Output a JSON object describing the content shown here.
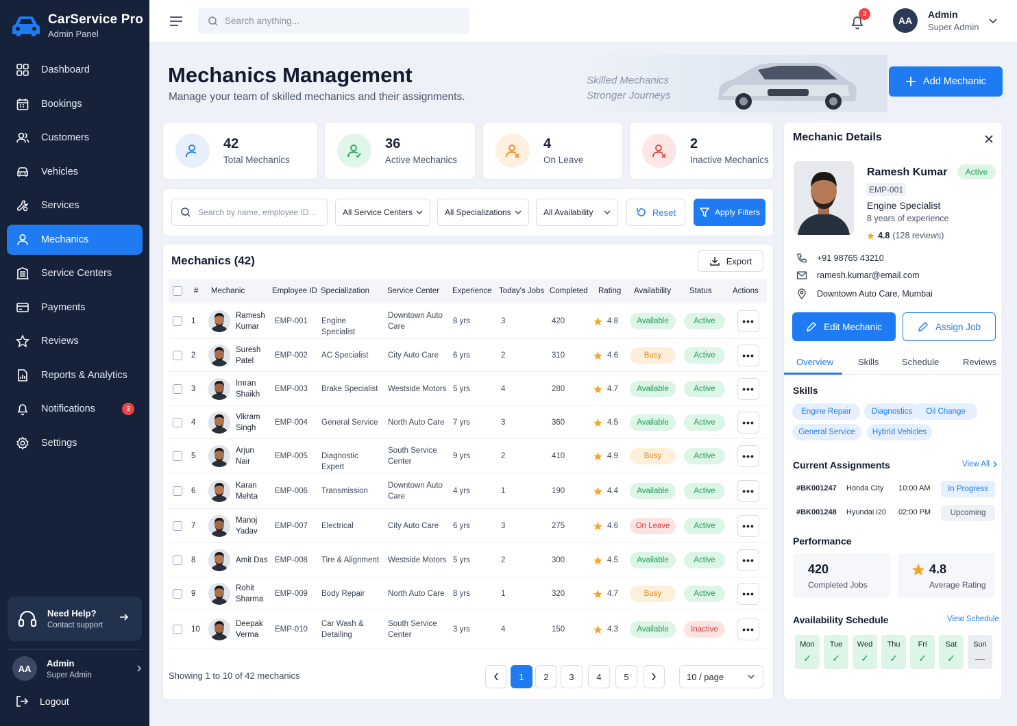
{
  "brand": {
    "name": "CarService Pro",
    "sub": "Admin Panel"
  },
  "nav": [
    {
      "label": "Dashboard",
      "icon": "dashboard-icon"
    },
    {
      "label": "Bookings",
      "icon": "calendar-icon"
    },
    {
      "label": "Customers",
      "icon": "users-icon"
    },
    {
      "label": "Vehicles",
      "icon": "car-icon"
    },
    {
      "label": "Services",
      "icon": "wrench-icon"
    },
    {
      "label": "Mechanics",
      "icon": "user-icon",
      "active": true
    },
    {
      "label": "Service Centers",
      "icon": "building-icon"
    },
    {
      "label": "Payments",
      "icon": "card-icon"
    },
    {
      "label": "Reviews",
      "icon": "star-icon"
    },
    {
      "label": "Reports & Analytics",
      "icon": "report-icon"
    },
    {
      "label": "Notifications",
      "icon": "bell-icon",
      "badge": "3"
    },
    {
      "label": "Settings",
      "icon": "gear-icon"
    }
  ],
  "help": {
    "title": "Need Help?",
    "sub": "Contact support"
  },
  "side_user": {
    "initials": "AA",
    "name": "Admin",
    "role": "Super Admin"
  },
  "logout": "Logout",
  "top": {
    "search_placeholder": "Search anything...",
    "notif_count": "3",
    "initials": "AA",
    "name": "Admin",
    "role": "Super Admin"
  },
  "header": {
    "title": "Mechanics Management",
    "subtitle": "Manage your team of skilled mechanics and their assignments.",
    "tagline1": "Skilled Mechanics",
    "tagline2": "Stronger Journeys",
    "add_label": "Add Mechanic"
  },
  "stats": [
    {
      "value": "42",
      "label": "Total Mechanics",
      "color": "#1f7bf2",
      "bg": "#e6f0ff"
    },
    {
      "value": "36",
      "label": "Active Mechanics",
      "color": "#22a35a",
      "bg": "#e1f6ea"
    },
    {
      "value": "4",
      "label": "On Leave",
      "color": "#f08a24",
      "bg": "#fff0e0"
    },
    {
      "value": "2",
      "label": "Inactive Mechanics",
      "color": "#e0443e",
      "bg": "#fde6e5"
    }
  ],
  "filters": {
    "search_placeholder": "Search by name, employee ID...",
    "centers": "All Service Centers",
    "specs": "All Specializations",
    "availability": "All Availability",
    "reset": "Reset",
    "apply": "Apply Filters"
  },
  "table": {
    "title": "Mechanics (42)",
    "export": "Export",
    "headers": [
      "#",
      "Mechanic",
      "Employee ID",
      "Specialization",
      "Service Center",
      "Experience",
      "Today's Jobs",
      "Completed",
      "Rating",
      "Availability",
      "Status",
      "Actions"
    ],
    "rows": [
      {
        "n": "1",
        "first": "Ramesh",
        "last": "Kumar",
        "id": "EMP-001",
        "spec": "Engine Specialist",
        "center": "Downtown Auto Care",
        "exp": "8 yrs",
        "today": "3",
        "done": "420",
        "rating": "4.8",
        "avail": "Available",
        "status": "Active"
      },
      {
        "n": "2",
        "first": "Suresh",
        "last": "Patel",
        "id": "EMP-002",
        "spec": "AC Specialist",
        "center": "City Auto Care",
        "exp": "6 yrs",
        "today": "2",
        "done": "310",
        "rating": "4.6",
        "avail": "Busy",
        "status": "Active"
      },
      {
        "n": "3",
        "first": "Imran",
        "last": "Shaikh",
        "id": "EMP-003",
        "spec": "Brake Specialist",
        "center": "Westside Motors",
        "exp": "5 yrs",
        "today": "4",
        "done": "280",
        "rating": "4.7",
        "avail": "Available",
        "status": "Active"
      },
      {
        "n": "4",
        "first": "Vikram",
        "last": "Singh",
        "id": "EMP-004",
        "spec": "General Service",
        "center": "North Auto Care",
        "exp": "7 yrs",
        "today": "3",
        "done": "360",
        "rating": "4.5",
        "avail": "Available",
        "status": "Active"
      },
      {
        "n": "5",
        "first": "Arjun",
        "last": "Nair",
        "id": "EMP-005",
        "spec": "Diagnostic Expert",
        "center": "South Service Center",
        "exp": "9 yrs",
        "today": "2",
        "done": "410",
        "rating": "4.9",
        "avail": "Busy",
        "status": "Active"
      },
      {
        "n": "6",
        "first": "Karan",
        "last": "Mehta",
        "id": "EMP-006",
        "spec": "Transmission",
        "center": "Downtown Auto Care",
        "exp": "4 yrs",
        "today": "1",
        "done": "190",
        "rating": "4.4",
        "avail": "Available",
        "status": "Active"
      },
      {
        "n": "7",
        "first": "Manoj",
        "last": "Yadav",
        "id": "EMP-007",
        "spec": "Electrical",
        "center": "City Auto Care",
        "exp": "6 yrs",
        "today": "3",
        "done": "275",
        "rating": "4.6",
        "avail": "On Leave",
        "status": "Active"
      },
      {
        "n": "8",
        "first": "Amit Das",
        "last": "",
        "id": "EMP-008",
        "spec": "Tire & Alignment",
        "center": "Westside Motors",
        "exp": "5 yrs",
        "today": "2",
        "done": "300",
        "rating": "4.5",
        "avail": "Available",
        "status": "Active"
      },
      {
        "n": "9",
        "first": "Rohit",
        "last": "Sharma",
        "id": "EMP-009",
        "spec": "Body Repair",
        "center": "North Auto Care",
        "exp": "8 yrs",
        "today": "1",
        "done": "320",
        "rating": "4.7",
        "avail": "Busy",
        "status": "Active"
      },
      {
        "n": "10",
        "first": "Deepak",
        "last": "Verma",
        "id": "EMP-010",
        "spec": "Car Wash & Detailing",
        "center": "South Service Center",
        "exp": "3 yrs",
        "today": "4",
        "done": "150",
        "rating": "4.3",
        "avail": "Available",
        "status": "Inactive"
      }
    ],
    "showing": "Showing 1 to 10 of 42 mechanics",
    "pages": [
      "1",
      "2",
      "3",
      "4",
      "5"
    ],
    "current_page": "1",
    "per_page": "10 / page",
    "actions_glyph": "•••"
  },
  "details": {
    "title": "Mechanic Details",
    "name": "Ramesh Kumar",
    "status": "Active",
    "emp": "EMP-001",
    "spec": "Engine Specialist",
    "exp": "8 years of experience",
    "rating": "4.8",
    "reviews": "(128 reviews)",
    "phone": "+91 98765 43210",
    "email": "ramesh.kumar@email.com",
    "location": "Downtown Auto Care, Mumbai",
    "edit": "Edit Mechanic",
    "assign": "Assign Job",
    "tabs": [
      "Overview",
      "Skills",
      "Schedule",
      "Reviews"
    ],
    "skills_title": "Skills",
    "skills": [
      "Engine Repair",
      "Diagnostics",
      "Oil Change",
      "General Service",
      "Hybrid Vehicles"
    ],
    "assign_title": "Current Assignments",
    "view_all": "View All",
    "assignments": [
      {
        "id": "#BK001247",
        "car": "Honda City",
        "time": "10:00 AM",
        "status": "In Progress"
      },
      {
        "id": "#BK001248",
        "car": "Hyundai i20",
        "time": "02:00 PM",
        "status": "Upcoming"
      }
    ],
    "perf_title": "Performance",
    "perf": [
      {
        "value": "420",
        "label": "Completed Jobs"
      },
      {
        "value": "4.8",
        "label": "Average Rating"
      }
    ],
    "sched_title": "Availability Schedule",
    "view_schedule": "View Schedule",
    "days": [
      {
        "d": "Mon",
        "mark": "✓"
      },
      {
        "d": "Tue",
        "mark": "✓"
      },
      {
        "d": "Wed",
        "mark": "✓"
      },
      {
        "d": "Thu",
        "mark": "✓"
      },
      {
        "d": "Fri",
        "mark": "✓"
      },
      {
        "d": "Sat",
        "mark": "✓"
      },
      {
        "d": "Sun",
        "mark": "—"
      }
    ]
  }
}
